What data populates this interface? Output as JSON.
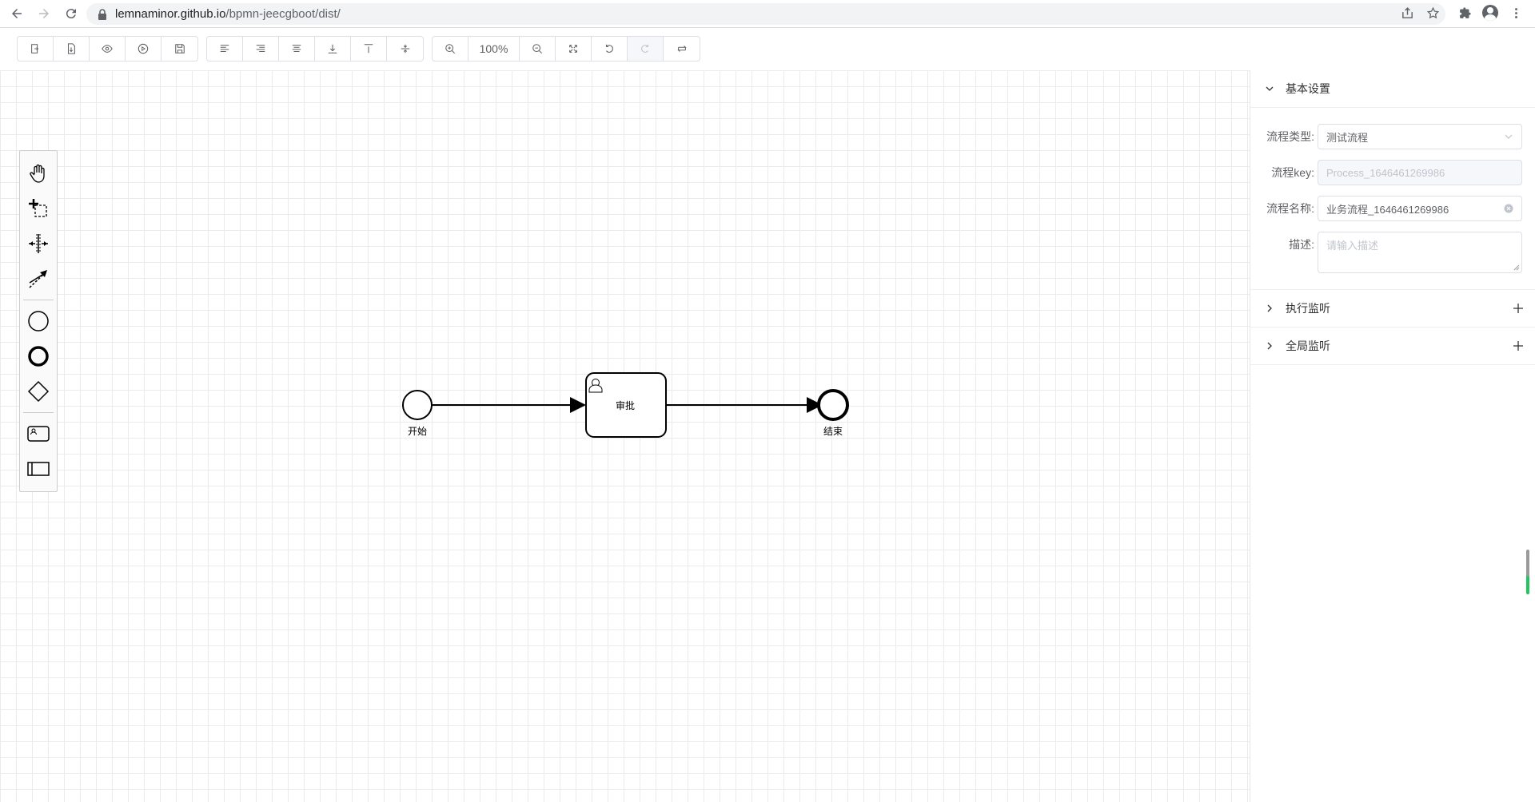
{
  "browser": {
    "url_host": "lemnaminor.github.io",
    "url_path": "/bpmn-jeecgboot/dist/"
  },
  "toolbar": {
    "zoom": "100%"
  },
  "diagram": {
    "start_label": "开始",
    "task_label": "审批",
    "end_label": "结束"
  },
  "panel": {
    "basic": {
      "title": "基本设置",
      "type_label": "流程类型:",
      "type_value": "测试流程",
      "key_label": "流程key:",
      "key_value": "Process_1646461269986",
      "name_label": "流程名称:",
      "name_value": "业务流程_1646461269986",
      "desc_label": "描述:",
      "desc_placeholder": "请输入描述"
    },
    "exec_listener": "执行监听",
    "global_listener": "全局监听"
  }
}
